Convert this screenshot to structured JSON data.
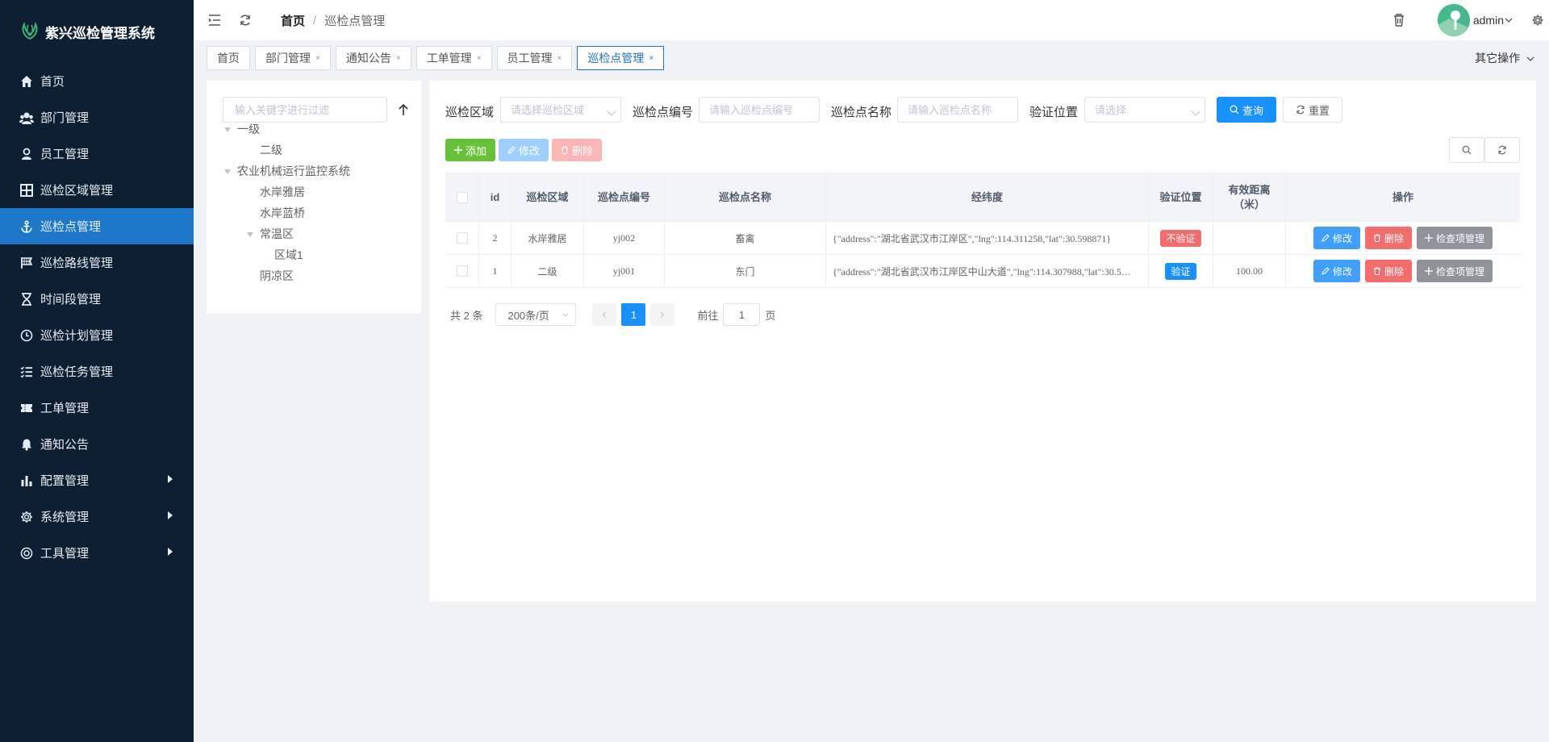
{
  "app": {
    "title": "紫兴巡检管理系统"
  },
  "colors": {
    "sidebar_bg": "#0f1f33",
    "active": "#1d78c9",
    "primary": "#1890ff",
    "success": "#67c23a",
    "danger": "#f56c6c",
    "info": "#909399"
  },
  "sidebar": {
    "items": [
      {
        "label": "首页",
        "icon": "home-icon"
      },
      {
        "label": "部门管理",
        "icon": "department-icon"
      },
      {
        "label": "员工管理",
        "icon": "user-icon"
      },
      {
        "label": "巡检区域管理",
        "icon": "grid-icon"
      },
      {
        "label": "巡检点管理",
        "icon": "anchor-icon",
        "active": true
      },
      {
        "label": "巡检路线管理",
        "icon": "flag-icon"
      },
      {
        "label": "时间段管理",
        "icon": "hourglass-icon"
      },
      {
        "label": "巡检计划管理",
        "icon": "clock-icon"
      },
      {
        "label": "巡检任务管理",
        "icon": "list-icon"
      },
      {
        "label": "工单管理",
        "icon": "ticket-icon"
      },
      {
        "label": "通知公告",
        "icon": "bell-icon"
      },
      {
        "label": "配置管理",
        "icon": "chart-icon",
        "submenu": true
      },
      {
        "label": "系统管理",
        "icon": "settings-icon",
        "submenu": true
      },
      {
        "label": "工具管理",
        "icon": "tool-icon",
        "submenu": true
      }
    ]
  },
  "navbar": {
    "breadcrumb": {
      "home": "首页",
      "current": "巡检点管理"
    },
    "username": "admin"
  },
  "tags": {
    "items": [
      {
        "label": "首页",
        "closable": false
      },
      {
        "label": "部门管理",
        "closable": true
      },
      {
        "label": "通知公告",
        "closable": true
      },
      {
        "label": "工单管理",
        "closable": true
      },
      {
        "label": "员工管理",
        "closable": true
      },
      {
        "label": "巡检点管理",
        "closable": true,
        "active": true
      }
    ],
    "close_glyph": "×",
    "other_ops": "其它操作"
  },
  "tree": {
    "filter_placeholder": "输入关键字进行过滤",
    "nodes": [
      {
        "label": "一级",
        "level": 1,
        "expanded": true
      },
      {
        "label": "二级",
        "level": 2
      },
      {
        "label": "农业机械运行监控系统",
        "level": 1,
        "expanded": true
      },
      {
        "label": "水岸雅居",
        "level": 2
      },
      {
        "label": "水岸蓝桥",
        "level": 2
      },
      {
        "label": "常温区",
        "level": 2,
        "expanded": true
      },
      {
        "label": "区域1",
        "level": 3
      },
      {
        "label": "阴凉区",
        "level": 2
      }
    ]
  },
  "search": {
    "area_label": "巡检区域",
    "area_placeholder": "请选择巡检区域",
    "code_label": "巡检点编号",
    "code_placeholder": "请输入巡检点编号",
    "name_label": "巡检点名称",
    "name_placeholder": "请输入巡检点名称",
    "verify_label": "验证位置",
    "verify_placeholder": "请选择",
    "query_button": "查询",
    "reset_button": "重置"
  },
  "toolbar": {
    "add": "添加",
    "edit": "修改",
    "delete": "删除"
  },
  "table": {
    "headers": {
      "id": "id",
      "area": "巡检区域",
      "code": "巡检点编号",
      "name": "巡检点名称",
      "coords": "经纬度",
      "verify": "验证位置",
      "distance_line1": "有效距离",
      "distance_line2": "（米）",
      "ops": "操作"
    },
    "rows": [
      {
        "id": "2",
        "area": "水岸雅居",
        "code": "yj002",
        "name": "畜禽",
        "coords": "{\"address\":\"湖北省武汉市江岸区\",\"lng\":114.311258,\"lat\":30.598871}",
        "verify": "不验证",
        "verify_type": "danger",
        "distance": ""
      },
      {
        "id": "1",
        "area": "二级",
        "code": "yj001",
        "name": "东门",
        "coords": "{\"address\":\"湖北省武汉市江岸区中山大道\",\"lng\":114.307988,\"lat\":30.5…",
        "verify": "验证",
        "verify_type": "primary",
        "distance": "100.00"
      }
    ],
    "row_actions": {
      "edit": "修改",
      "delete": "删除",
      "manage": "检查项管理"
    }
  },
  "pagination": {
    "total": "共 2 条",
    "page_size": "200条/页",
    "current_page": "1",
    "goto_prefix": "前往",
    "goto_value": "1",
    "goto_suffix": "页"
  }
}
